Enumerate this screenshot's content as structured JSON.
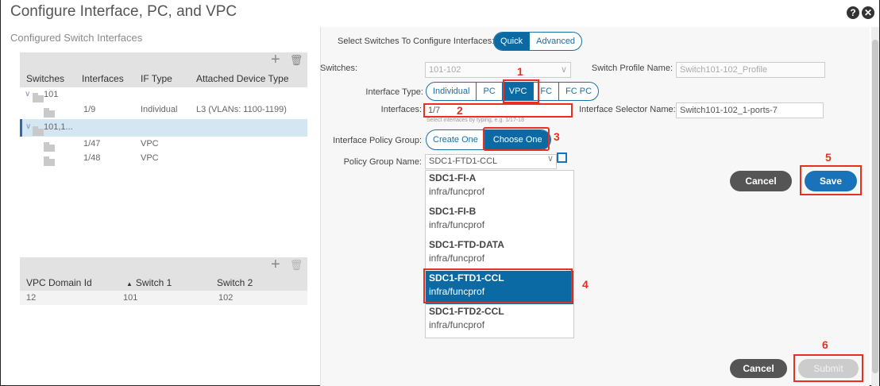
{
  "window": {
    "title": "Configure Interface, PC, and VPC"
  },
  "left": {
    "subtitle": "Configured Switch Interfaces",
    "interfaces_table": {
      "columns": [
        "Switches",
        "Interfaces",
        "IF Type",
        "Attached Device Type"
      ],
      "rows": [
        {
          "switches": "101",
          "interfaces": "",
          "if_type": "",
          "device": ""
        },
        {
          "switches": "",
          "interfaces": "1/9",
          "if_type": "Individual",
          "device": "L3 (VLANs: 1100-1199)"
        },
        {
          "switches": "101,1...",
          "interfaces": "",
          "if_type": "",
          "device": ""
        },
        {
          "switches": "",
          "interfaces": "1/47",
          "if_type": "VPC",
          "device": ""
        },
        {
          "switches": "",
          "interfaces": "1/48",
          "if_type": "VPC",
          "device": ""
        }
      ]
    },
    "vpc_table": {
      "columns": [
        "VPC Domain Id",
        "Switch 1",
        "Switch 2"
      ],
      "rows": [
        {
          "domain": "12",
          "switch1": "101",
          "switch2": "102"
        }
      ]
    }
  },
  "right": {
    "select_label": "Select Switches To Configure Interfaces:",
    "mode_tabs": [
      "Quick",
      "Advanced"
    ],
    "switches_label": "Switches:",
    "switches_value": "101-102",
    "profile_label": "Switch Profile Name:",
    "profile_value": "Switch101-102_Profile",
    "iftype_label": "Interface Type:",
    "iftype_options": [
      "Individual",
      "PC",
      "VPC",
      "FC",
      "FC PC"
    ],
    "interfaces_label": "Interfaces:",
    "interfaces_value": "1/7",
    "interfaces_hint": "Select interfaces by typing, e.g. 1/17-18",
    "selector_label": "Interface Selector Name:",
    "selector_value": "Switch101-102_1-ports-7",
    "ipg_label": "Interface Policy Group:",
    "ipg_options": [
      "Create One",
      "Choose One"
    ],
    "pgname_label": "Policy Group Name:",
    "pgname_value": "SDC1-FTD1-CCL",
    "dropdown": [
      {
        "title": "SDC1-FI-A",
        "sub": "infra/funcprof"
      },
      {
        "title": "SDC1-FI-B",
        "sub": "infra/funcprof"
      },
      {
        "title": "SDC1-FTD-DATA",
        "sub": "infra/funcprof"
      },
      {
        "title": "SDC1-FTD1-CCL",
        "sub": "infra/funcprof"
      },
      {
        "title": "SDC1-FTD2-CCL",
        "sub": "infra/funcprof"
      }
    ],
    "cancel_label": "Cancel",
    "save_label": "Save",
    "submit_label": "Submit"
  },
  "callouts": [
    "1",
    "2",
    "3",
    "4",
    "5",
    "6"
  ],
  "icons": {
    "help": "?",
    "close": "✕",
    "add": "+",
    "delete": "🗑"
  },
  "colors": {
    "accent": "#0b6aa3",
    "callout": "#e53022"
  }
}
